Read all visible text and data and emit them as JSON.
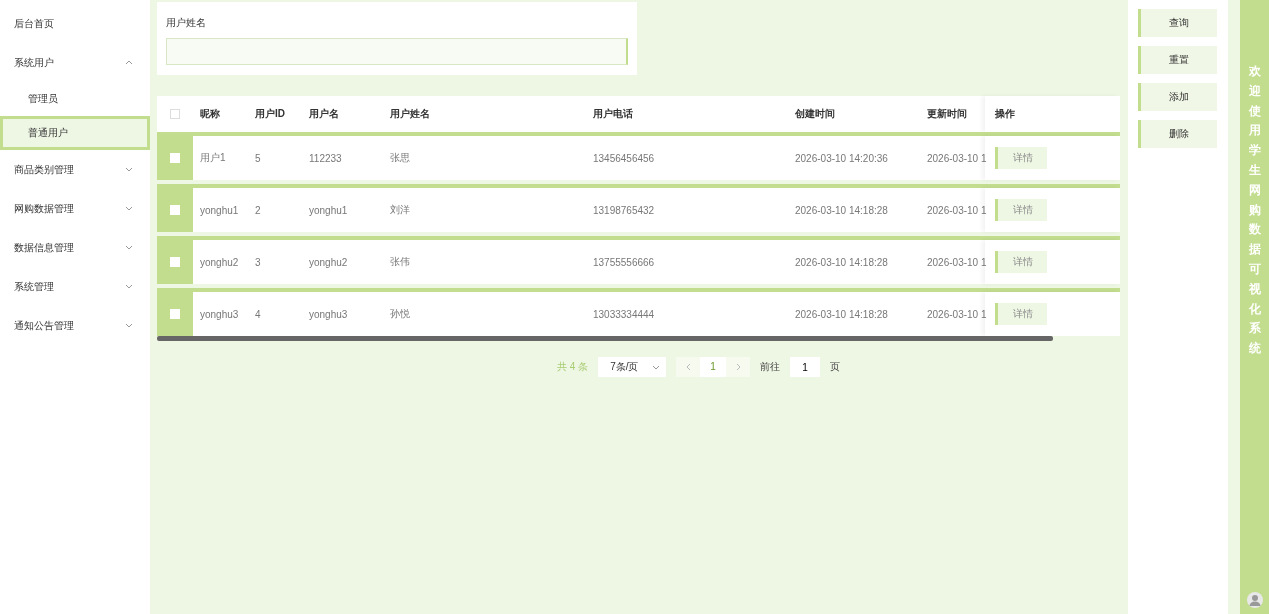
{
  "sidebar": {
    "items": [
      {
        "label": "后台首页",
        "selected": false
      },
      {
        "label": "系统用户",
        "expanded": true,
        "children": [
          {
            "label": "管理员",
            "selected": false
          },
          {
            "label": "普通用户",
            "selected": true
          }
        ]
      },
      {
        "label": "商品类别管理",
        "expanded": false
      },
      {
        "label": "网购数据管理",
        "expanded": false
      },
      {
        "label": "数据信息管理",
        "expanded": false
      },
      {
        "label": "系统管理",
        "expanded": false
      },
      {
        "label": "通知公告管理",
        "expanded": false
      }
    ]
  },
  "search": {
    "label": "用户姓名"
  },
  "table": {
    "all_checked": false,
    "columns": [
      "昵称",
      "用户ID",
      "用户名",
      "用户姓名",
      "用户电话",
      "创建时间",
      "更新时间",
      "操作"
    ],
    "rows": [
      {
        "checked": false,
        "cells": [
          "用户1",
          "5",
          "112233",
          "张思",
          "13456456456",
          "2026-03-10 14:20:36",
          "2026-03-10 1"
        ],
        "action": "详情"
      },
      {
        "checked": false,
        "cells": [
          "yonghu1",
          "2",
          "yonghu1",
          "刘洋",
          "13198765432",
          "2026-03-10 14:18:28",
          "2026-03-10 1"
        ],
        "action": "详情"
      },
      {
        "checked": false,
        "cells": [
          "yonghu2",
          "3",
          "yonghu2",
          "张伟",
          "13755556666",
          "2026-03-10 14:18:28",
          "2026-03-10 1"
        ],
        "action": "详情"
      },
      {
        "checked": false,
        "cells": [
          "yonghu3",
          "4",
          "yonghu3",
          "孙悦",
          "13033334444",
          "2026-03-10 14:18:28",
          "2026-03-10 1"
        ],
        "action": "详情"
      }
    ]
  },
  "pagination": {
    "total": "共 4 条",
    "page_size": "7条/页",
    "current_page": "1",
    "goto_label": "前往",
    "goto_value": "1",
    "page_unit": "页"
  },
  "actions": [
    "查询",
    "重置",
    "添加",
    "删除"
  ],
  "banner": {
    "text": "欢迎使用学生网购数据可视化系统"
  }
}
